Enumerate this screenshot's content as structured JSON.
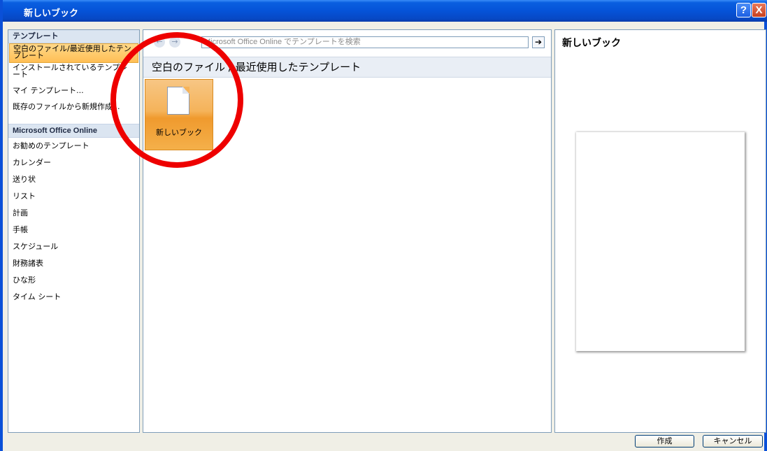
{
  "window": {
    "title": "新しいブック",
    "help_label": "?",
    "close_label": "X"
  },
  "sidebar": {
    "header": "テンプレート",
    "items": [
      "空白のファイル/最近使用したテンプレート",
      "インストールされているテンプレート",
      "マイ テンプレート...",
      "既存のファイルから新規作成..."
    ],
    "online_header": "Microsoft Office Online",
    "categories": [
      "お勧めのテンプレート",
      "カレンダー",
      "送り状",
      "リスト",
      "計画",
      "手帳",
      "スケジュール",
      "財務諸表",
      "ひな形",
      "タイム シート"
    ]
  },
  "center": {
    "search_placeholder": "Microsoft Office Online でテンプレートを検索",
    "back_icon": "←",
    "forward_icon": "→",
    "go_icon": "➔",
    "section_title": "空白のファイル / 最近使用したテンプレート",
    "tile_label": "新しいブック"
  },
  "preview": {
    "title": "新しいブック"
  },
  "buttons": {
    "create": "作成",
    "cancel": "キャンセル"
  },
  "colors": {
    "title_bar": "#0553d8",
    "selection": "#ffbf55",
    "annotation": "#e00000"
  }
}
